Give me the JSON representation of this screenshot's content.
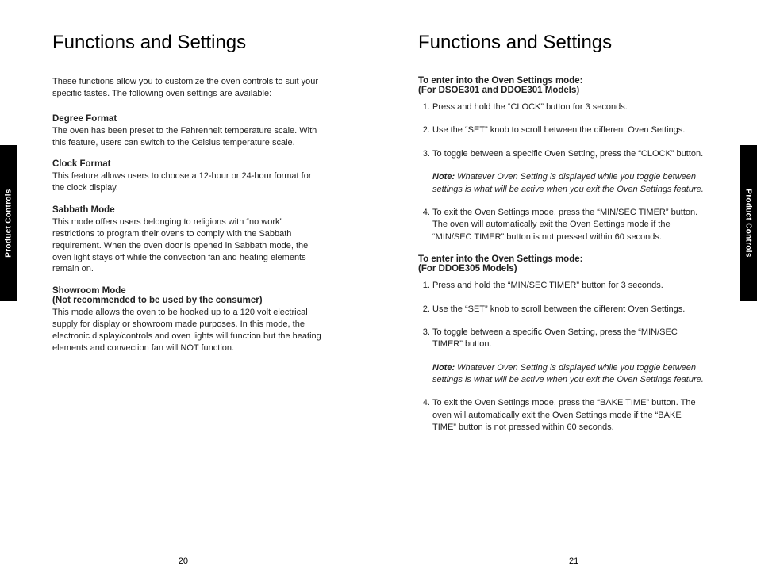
{
  "left": {
    "title": "Functions and Settings",
    "intro": "These functions allow you to customize the oven controls to suit your specific tastes. The following oven settings are available:",
    "sections": [
      {
        "head": "Degree Format",
        "body": "The oven has been preset to the Fahrenheit temperature scale. With this feature, users can switch to the Celsius temperature scale."
      },
      {
        "head": "Clock Format",
        "body": "This feature allows users to choose a 12-hour or 24-hour format for the clock display."
      },
      {
        "head": "Sabbath Mode",
        "body": "This mode offers users belonging to religions with “no work” restrictions to program their ovens to comply with the Sabbath requirement. When the oven door is opened in Sabbath mode, the oven light stays off while the convection fan and heating elements remain on."
      },
      {
        "head": "Showroom Mode",
        "subhead": "(Not recommended to be used by the consumer)",
        "body": "This mode allows the oven to be hooked up to a 120 volt electrical supply for display or showroom made purposes. In this mode, the electronic display/controls and oven lights will function but the heating elements and convection fan will NOT function."
      }
    ],
    "tab": "Product Controls",
    "pagenum": "20"
  },
  "right": {
    "title": "Functions and Settings",
    "procA": {
      "head": "To enter into the Oven Settings mode:",
      "subhead": "(For DSOE301 and DDOE301 Models)",
      "steps": [
        "Press and hold the “CLOCK” button for 3 seconds.",
        "Use the “SET” knob to scroll between the different Oven Settings.",
        "To toggle between a specific Oven Setting, press the “CLOCK” button.",
        "To exit the Oven Settings mode, press the “MIN/SEC TIMER” button. The oven will automatically exit the Oven Settings mode if the “MIN/SEC TIMER” button is not pressed within 60 seconds."
      ],
      "noteLabel": "Note:",
      "note": "Whatever Oven Setting is displayed while you toggle between settings is what will be active when you exit the Oven Settings feature."
    },
    "procB": {
      "head": "To enter into the Oven Settings mode:",
      "subhead": "(For DDOE305 Models)",
      "steps": [
        "Press and hold the “MIN/SEC TIMER” button for 3 seconds.",
        "Use the “SET” knob to scroll between the different Oven Settings.",
        "To toggle between a specific Oven Setting, press the “MIN/SEC TIMER” button.",
        "To exit the Oven Settings mode, press the “BAKE TIME” button. The oven will automatically exit the Oven Settings mode if the “BAKE TIME” button is not pressed within 60 seconds."
      ],
      "noteLabel": "Note:",
      "note": "Whatever Oven Setting is displayed while you toggle between settings is what will be active when you exit the Oven Settings feature."
    },
    "tab": "Product Controls",
    "pagenum": "21"
  }
}
